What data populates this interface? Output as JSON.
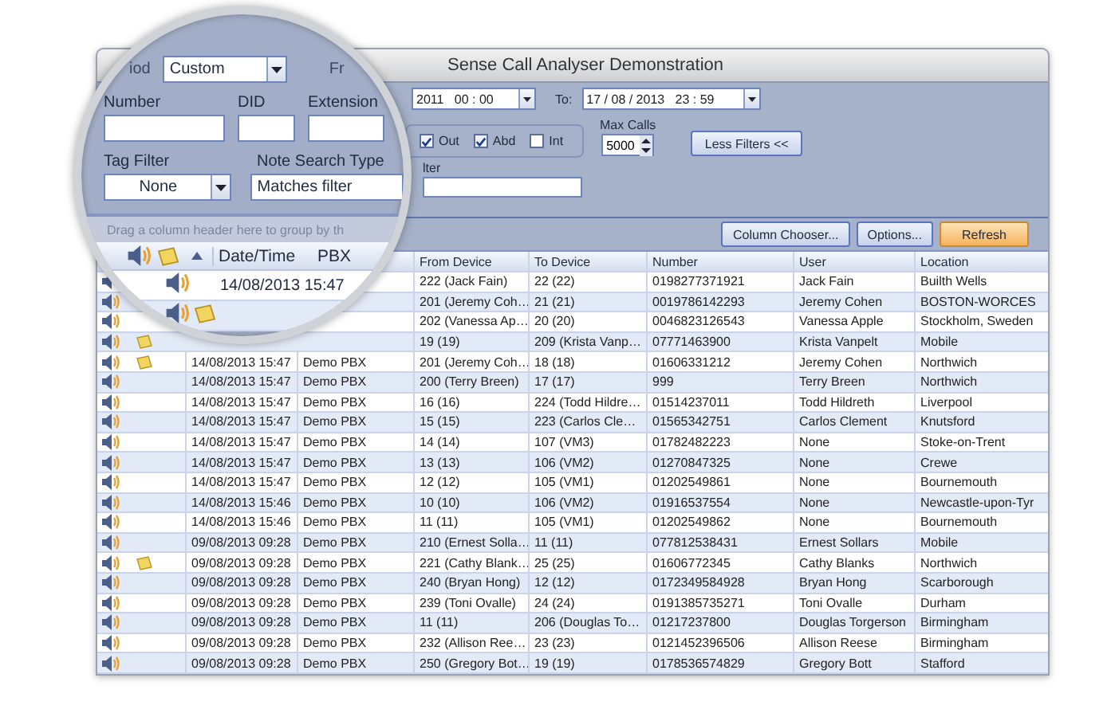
{
  "window": {
    "title": "Sense Call Analyser Demonstration"
  },
  "filters": {
    "from_value": "2011   00 : 00",
    "to_label": "To:",
    "to_value": "17 / 08 / 2013   23 : 59",
    "directions": [
      {
        "label": "Out",
        "checked": true
      },
      {
        "label": "Abd",
        "checked": true
      },
      {
        "label": "Int",
        "checked": false
      }
    ],
    "max_calls_label": "Max Calls",
    "max_calls_value": "5000",
    "less_filters_button": "Less Filters <<",
    "note_filter_label": "lter"
  },
  "toolbar": {
    "buttons": [
      {
        "label": "Column Chooser...",
        "kind": "normal"
      },
      {
        "label": "Options...",
        "kind": "normal"
      },
      {
        "label": "Refresh",
        "kind": "highlight"
      }
    ]
  },
  "table": {
    "columns": [
      "From Device",
      "To Device",
      "Number",
      "User",
      "Location"
    ],
    "rows": [
      {
        "has_note": false,
        "from_device": "222 (Jack Fain)",
        "to_device": "22 (22)",
        "number": "0198277371921",
        "user": "Jack Fain",
        "location": "Builth Wells"
      },
      {
        "has_note": false,
        "from_device": "201 (Jeremy Coh…",
        "to_device": "21 (21)",
        "number": "0019786142293",
        "user": "Jeremy Cohen",
        "location": "BOSTON-WORCES"
      },
      {
        "has_note": false,
        "from_device": "202 (Vanessa Ap…",
        "to_device": "20 (20)",
        "number": "0046823126543",
        "user": "Vanessa Apple",
        "location": "Stockholm, Sweden"
      },
      {
        "has_note": true,
        "from_device": "19 (19)",
        "to_device": "209 (Krista Vanp…",
        "number": "07771463900",
        "user": "Krista Vanpelt",
        "location": "Mobile"
      },
      {
        "has_note": true,
        "date": "14/08/2013 15:47",
        "pbx": "Demo PBX",
        "from_device": "201 (Jeremy Coh…",
        "to_device": "18 (18)",
        "number": "01606331212",
        "user": "Jeremy Cohen",
        "location": "Northwich"
      },
      {
        "has_note": false,
        "date": "14/08/2013 15:47",
        "pbx": "Demo PBX",
        "from_device": "200 (Terry Breen)",
        "to_device": "17 (17)",
        "number": "999",
        "user": "Terry Breen",
        "location": "Northwich"
      },
      {
        "has_note": false,
        "date": "14/08/2013 15:47",
        "pbx": "Demo PBX",
        "from_device": "16 (16)",
        "to_device": "224 (Todd Hildre…",
        "number": "01514237011",
        "user": "Todd Hildreth",
        "location": "Liverpool"
      },
      {
        "has_note": false,
        "date": "14/08/2013 15:47",
        "pbx": "Demo PBX",
        "from_device": "15 (15)",
        "to_device": "223 (Carlos Cle…",
        "number": "01565342751",
        "user": "Carlos Clement",
        "location": "Knutsford"
      },
      {
        "has_note": false,
        "date": "14/08/2013 15:47",
        "pbx": "Demo PBX",
        "from_device": "14 (14)",
        "to_device": "107 (VM3)",
        "number": "01782482223",
        "user": "None",
        "location": "Stoke-on-Trent"
      },
      {
        "has_note": false,
        "date": "14/08/2013 15:47",
        "pbx": "Demo PBX",
        "from_device": "13 (13)",
        "to_device": "106 (VM2)",
        "number": "01270847325",
        "user": "None",
        "location": "Crewe"
      },
      {
        "has_note": false,
        "date": "14/08/2013 15:47",
        "pbx": "Demo PBX",
        "from_device": "12 (12)",
        "to_device": "105 (VM1)",
        "number": "01202549861",
        "user": "None",
        "location": "Bournemouth"
      },
      {
        "has_note": false,
        "date": "14/08/2013 15:46",
        "pbx": "Demo PBX",
        "from_device": "10 (10)",
        "to_device": "106 (VM2)",
        "number": "01916537554",
        "user": "None",
        "location": "Newcastle-upon-Tyr"
      },
      {
        "has_note": false,
        "date": "14/08/2013 15:46",
        "pbx": "Demo PBX",
        "from_device": "11 (11)",
        "to_device": "105 (VM1)",
        "number": "01202549862",
        "user": "None",
        "location": "Bournemouth"
      },
      {
        "has_note": false,
        "date": "09/08/2013 09:28",
        "pbx": "Demo PBX",
        "from_device": "210 (Ernest Solla…",
        "to_device": "11 (11)",
        "number": "077812538431",
        "user": "Ernest Sollars",
        "location": "Mobile"
      },
      {
        "has_note": true,
        "date": "09/08/2013 09:28",
        "pbx": "Demo PBX",
        "from_device": "221 (Cathy Blank…",
        "to_device": "25 (25)",
        "number": "01606772345",
        "user": "Cathy Blanks",
        "location": "Northwich"
      },
      {
        "has_note": false,
        "date": "09/08/2013 09:28",
        "pbx": "Demo PBX",
        "from_device": "240 (Bryan Hong)",
        "to_device": "12 (12)",
        "number": "0172349584928",
        "user": "Bryan Hong",
        "location": "Scarborough"
      },
      {
        "has_note": false,
        "date": "09/08/2013 09:28",
        "pbx": "Demo PBX",
        "from_device": "239 (Toni Ovalle)",
        "to_device": "24 (24)",
        "number": "0191385735271",
        "user": "Toni Ovalle",
        "location": "Durham"
      },
      {
        "has_note": false,
        "date": "09/08/2013 09:28",
        "pbx": "Demo PBX",
        "from_device": "11 (11)",
        "to_device": "206 (Douglas To…",
        "number": "01217237800",
        "user": "Douglas Torgerson",
        "location": "Birmingham"
      },
      {
        "has_note": false,
        "date": "09/08/2013 09:28",
        "pbx": "Demo PBX",
        "from_device": "232 (Allison Ree…",
        "to_device": "23 (23)",
        "number": "0121452396506",
        "user": "Allison Reese",
        "location": "Birmingham"
      },
      {
        "has_note": false,
        "date": "09/08/2013 09:28",
        "pbx": "Demo PBX",
        "from_device": "250 (Gregory Bot…",
        "to_device": "19 (19)",
        "number": "0178536574829",
        "user": "Gregory Bott",
        "location": "Stafford"
      }
    ]
  },
  "magnifier": {
    "period_label": "iod",
    "period_value": "Custom",
    "from_label": "Fr",
    "number_label": "Number",
    "did_label": "DID",
    "extension_label": "Extension",
    "tag_filter_label": "Tag Filter",
    "tag_filter_value": "None",
    "note_search_label": "Note Search Type",
    "note_search_value": "Matches filter",
    "group_hint": "Drag a column header here to group by th",
    "columns": [
      "Date/Time",
      "PBX"
    ],
    "rows": [
      {
        "has_note": false,
        "date": "14/08/2013 15:47"
      },
      {
        "has_note": true
      }
    ]
  }
}
